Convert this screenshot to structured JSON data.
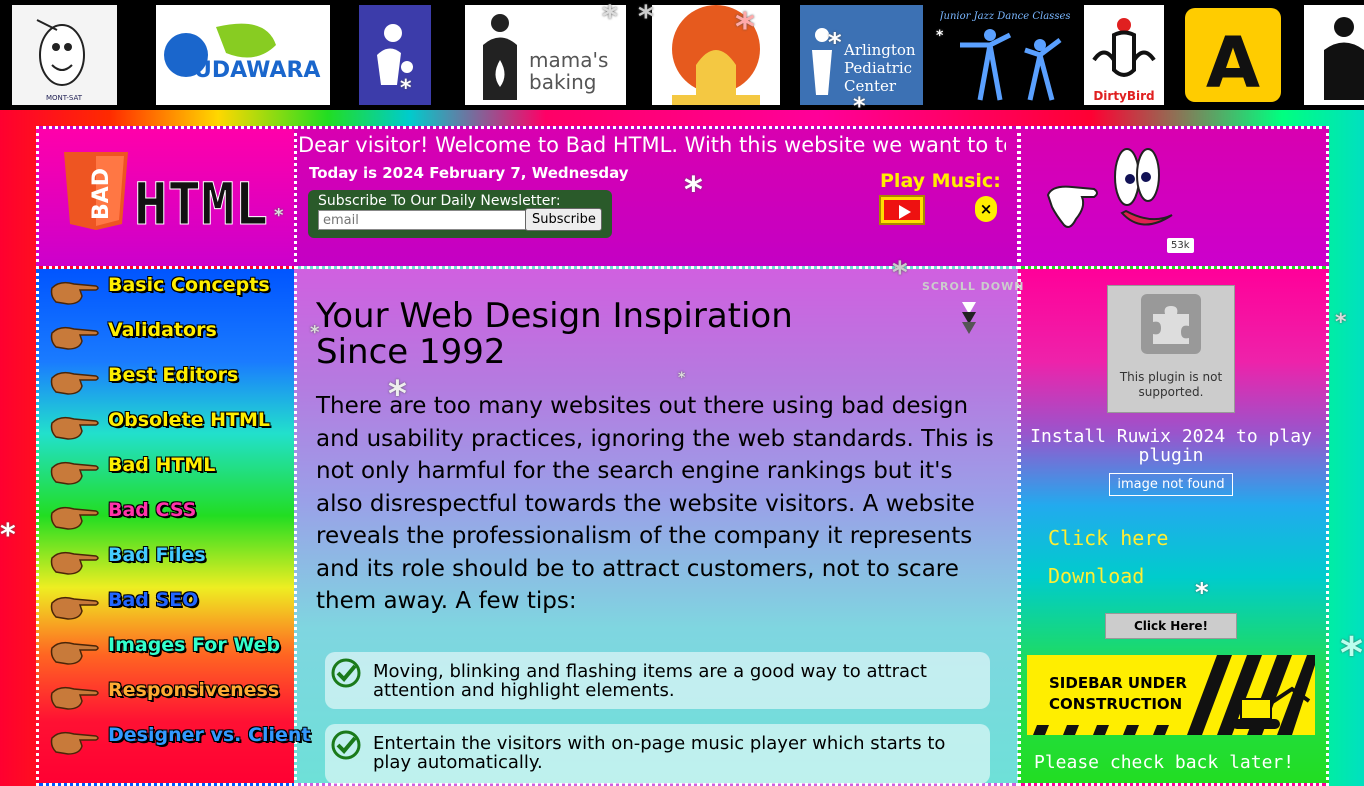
{
  "colors": {
    "accent_yellow": "#ffee00",
    "nav_text_yellow": "#ffee00",
    "brand_orange": "#ee5522"
  },
  "top_logos": [
    {
      "name": "Mont-Sat",
      "label": "MONT-SAT"
    },
    {
      "name": "Kudawara",
      "label": "UDAWARA"
    },
    {
      "name": "children-clinic",
      "label": ""
    },
    {
      "name": "mamas-baking",
      "label": "mama's baking"
    },
    {
      "name": "sunset-temple",
      "label": ""
    },
    {
      "name": "arlington-pediatric",
      "label": "Arlington Pediatric Center"
    },
    {
      "name": "junior-jazz",
      "label": "Junior Jazz Dance Classes"
    },
    {
      "name": "dirtybird",
      "label": "DirtyBird"
    },
    {
      "name": "a-sign",
      "label": "A"
    },
    {
      "name": "person-icon",
      "label": ""
    }
  ],
  "header": {
    "logo_bad": "BAD",
    "logo_html": "HTML",
    "welcome": "Dear visitor! Welcome to Bad HTML. With this website we want to teach",
    "today": "Today is 2024 February 7, Wednesday",
    "newsletter_label": "Subscribe To Our Daily Newsletter:",
    "email_placeholder": "email",
    "subscribe_label": "Subscribe",
    "play_music": "Play Music:",
    "close_symbol": "×",
    "counter_badge": "53k"
  },
  "nav": {
    "items": [
      {
        "label": "Basic Concepts",
        "color": "#ffee00"
      },
      {
        "label": "Validators",
        "color": "#ffee00"
      },
      {
        "label": "Best Editors",
        "color": "#ffee00"
      },
      {
        "label": "Obsolete HTML",
        "color": "#ffee00"
      },
      {
        "label": "Bad HTML",
        "color": "#ffee00"
      },
      {
        "label": "Bad CSS",
        "color": "#ff33aa"
      },
      {
        "label": "Bad Files",
        "color": "#44ccff"
      },
      {
        "label": "Bad SEO",
        "color": "#2266ff"
      },
      {
        "label": "Images For Web",
        "color": "#33ffcc"
      },
      {
        "label": "Responsiveness",
        "color": "#ffaa33"
      },
      {
        "label": "Designer vs. Client",
        "color": "#3399ff"
      }
    ]
  },
  "main": {
    "scroll_hint": "SCROLL DOWN",
    "title_line1": "Your Web Design Inspiration",
    "title_line2": "Since 1992",
    "intro": "There are too many websites out there using bad design and usability practices, ignoring the web standards. This is not only harmful for the search engine rankings but it's also disrespectful towards the website visitors. A website reveals the professionalism of the company it represents and its role should be to attract customers, not to scare them away. A few tips:",
    "tips": [
      "Moving, blinking and flashing items are a good way to attract attention and highlight elements.",
      "Entertain the visitors with on-page music player which starts to play automatically."
    ]
  },
  "sidebar": {
    "plugin_unsupported": "This plugin is not supported.",
    "install_text": "Install Ruwix 2024 to play plugin",
    "image_not_found": "image not found",
    "click_here_link": "Click here",
    "download_link": "Download",
    "click_here_button": "Click Here!",
    "construction_line1": "SIDEBAR UNDER",
    "construction_line2": "CONSTRUCTION",
    "check_back": "Please check back later!"
  }
}
